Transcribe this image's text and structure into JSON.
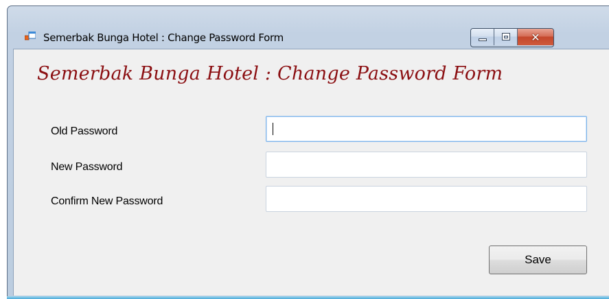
{
  "window": {
    "title": "Semerbak Bunga Hotel : Change Password Form",
    "icon": "windows-form-icon",
    "controls": {
      "minimize": "minimize-icon",
      "maximize": "maximize-icon",
      "close": "✕"
    }
  },
  "form": {
    "heading": "Semerbak Bunga Hotel : Change Password Form",
    "heading_color": "#8b0f12",
    "fields": [
      {
        "label": "Old Password",
        "value": "",
        "placeholder": ""
      },
      {
        "label": "New Password",
        "value": "",
        "placeholder": ""
      },
      {
        "label": "Confirm New Password",
        "value": "",
        "placeholder": ""
      }
    ],
    "save_label": "Save"
  }
}
